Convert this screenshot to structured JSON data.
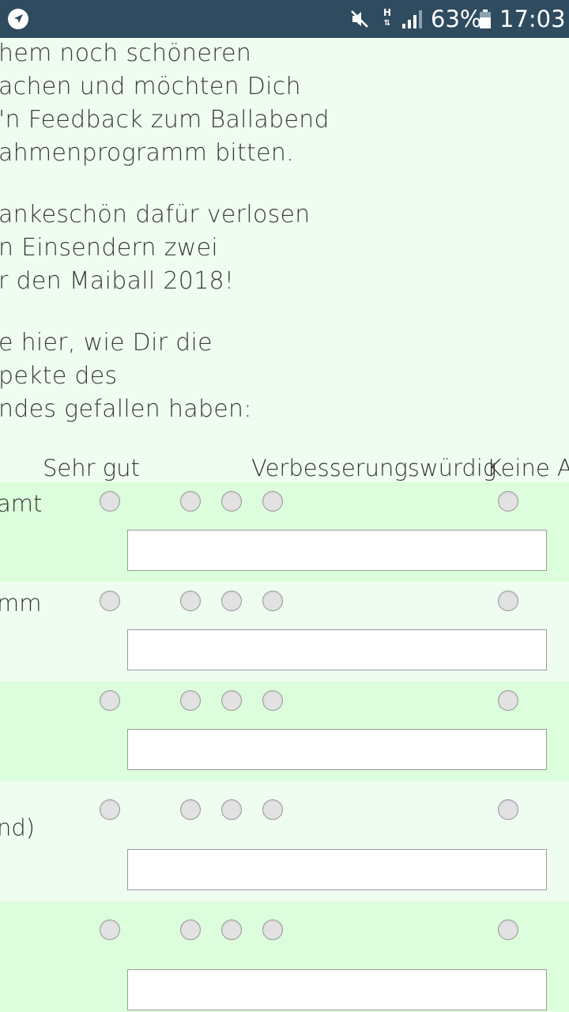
{
  "status_bar": {
    "battery_percent": "63%",
    "time": "17:03",
    "network_type": "H",
    "icons": [
      "navigation-icon",
      "mute-icon",
      "network-h-icon",
      "signal-icon",
      "battery-icon"
    ]
  },
  "intro": {
    "lines": [
      "hem noch schöneren",
      "achen und möchten Dich",
      "'n Feedback zum Ballabend",
      "ahmenprogramm bitten.",
      "ankeschön dafür verlosen",
      "n Einsendern zwei",
      "r den Maiball 2018!",
      "e hier, wie Dir die",
      "pekte des",
      "ndes gefallen haben:"
    ]
  },
  "survey": {
    "columns": [
      "Sehr gut",
      "Verbesserungswürdig",
      "Keine A"
    ],
    "rows": [
      {
        "label": "amt",
        "comment_value": ""
      },
      {
        "label": "mm",
        "comment_value": ""
      },
      {
        "label": "",
        "comment_value": ""
      },
      {
        "label": "nd)",
        "comment_value": ""
      },
      {
        "label": "",
        "comment_value": ""
      }
    ]
  }
}
